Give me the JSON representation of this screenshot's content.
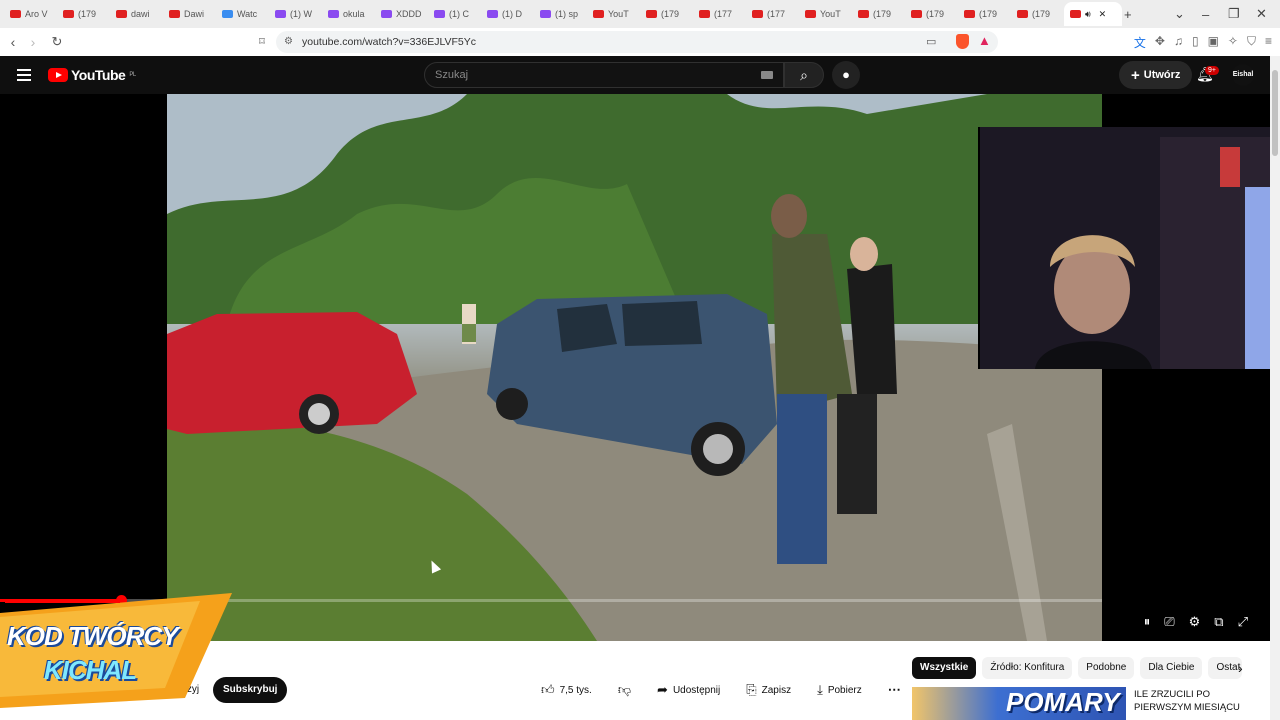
{
  "browser": {
    "tabs": [
      {
        "label": "Aro V",
        "color": "#e02020"
      },
      {
        "label": "(179",
        "color": "#e02020"
      },
      {
        "label": "dawi",
        "color": "#e02020"
      },
      {
        "label": "Dawi",
        "color": "#e02020"
      },
      {
        "label": "Watc",
        "color": "#3a8df0"
      },
      {
        "label": "(1) W",
        "color": "#8a4af0"
      },
      {
        "label": "okula",
        "color": "#8a4af0"
      },
      {
        "label": "XDDD",
        "color": "#8a4af0"
      },
      {
        "label": "(1) C",
        "color": "#8a4af0"
      },
      {
        "label": "(1) D",
        "color": "#8a4af0"
      },
      {
        "label": "(1) sp",
        "color": "#8a4af0"
      },
      {
        "label": "YouT",
        "color": "#e02020"
      },
      {
        "label": "(179",
        "color": "#e02020"
      },
      {
        "label": "(177",
        "color": "#e02020"
      },
      {
        "label": "(177",
        "color": "#e02020"
      },
      {
        "label": "YouT",
        "color": "#e02020"
      },
      {
        "label": "(179",
        "color": "#e02020"
      },
      {
        "label": "(179",
        "color": "#e02020"
      },
      {
        "label": "(179",
        "color": "#e02020"
      },
      {
        "label": "(179",
        "color": "#e02020"
      }
    ],
    "active_tab_label": "",
    "url": "youtube.com/watch?v=336EJLVF5Yc"
  },
  "youtube": {
    "logo_text": "YouTube",
    "region": "PL",
    "search_placeholder": "Szukaj",
    "create_label": "Utwórz",
    "notif_count": "9+",
    "avatar_text": "Eishal"
  },
  "overlay": {
    "line1": "KOD TWÓRCY",
    "line2": "KICHAL"
  },
  "player": {
    "progress_fraction": 0.11
  },
  "below": {
    "subscribed_partial": "sprzyj",
    "subscribe_label": "Subskrybuj",
    "likes": "7,5 tys.",
    "share": "Udostępnij",
    "save": "Zapisz",
    "download": "Pobierz"
  },
  "chips": [
    "Wszystkie",
    "Źródło: Konfitura",
    "Podobne",
    "Dla Ciebie",
    "Ostat"
  ],
  "recommendation": {
    "thumb_text": "POMARY",
    "title": "ILE ZRZUCILI PO PIERWSZYM MIESIĄCU"
  }
}
